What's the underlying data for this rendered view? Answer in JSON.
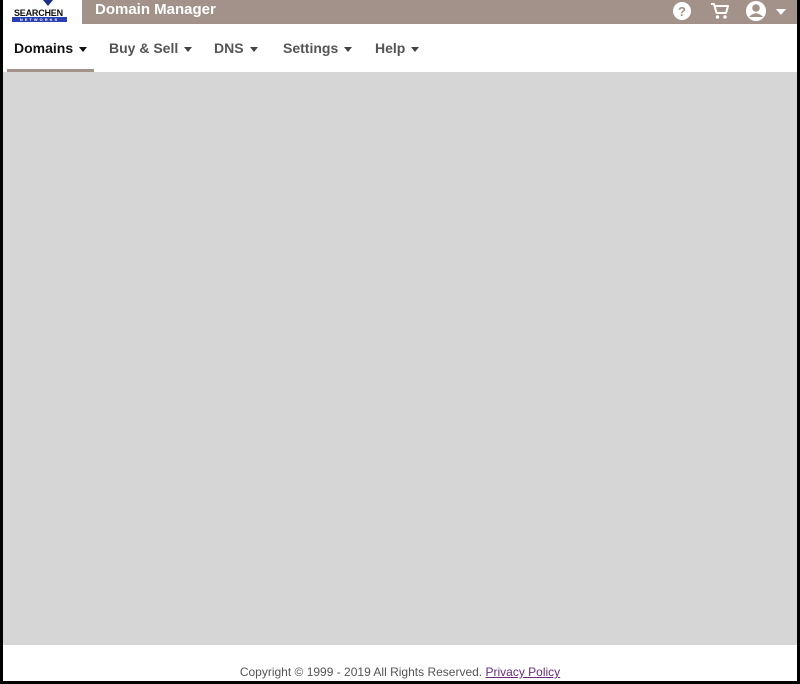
{
  "header": {
    "logo_text": "SEARCHEN",
    "logo_subtext": "NETWORKS",
    "app_title": "Domain Manager",
    "help_glyph": "?",
    "icons": [
      "help-icon",
      "cart-icon",
      "account-icon",
      "chevron-down-icon"
    ],
    "bar_color": "#a3928a"
  },
  "nav": {
    "items": [
      {
        "label": "Domains",
        "active": true
      },
      {
        "label": "Buy & Sell",
        "active": false
      },
      {
        "label": "DNS",
        "active": false
      },
      {
        "label": "Settings",
        "active": false
      },
      {
        "label": "Help",
        "active": false
      }
    ]
  },
  "main": {
    "background_color": "#d6d6d6"
  },
  "footer": {
    "copyright": "Copyright © 1999 - 2019 All Rights Reserved.",
    "privacy_link": "Privacy Policy"
  }
}
